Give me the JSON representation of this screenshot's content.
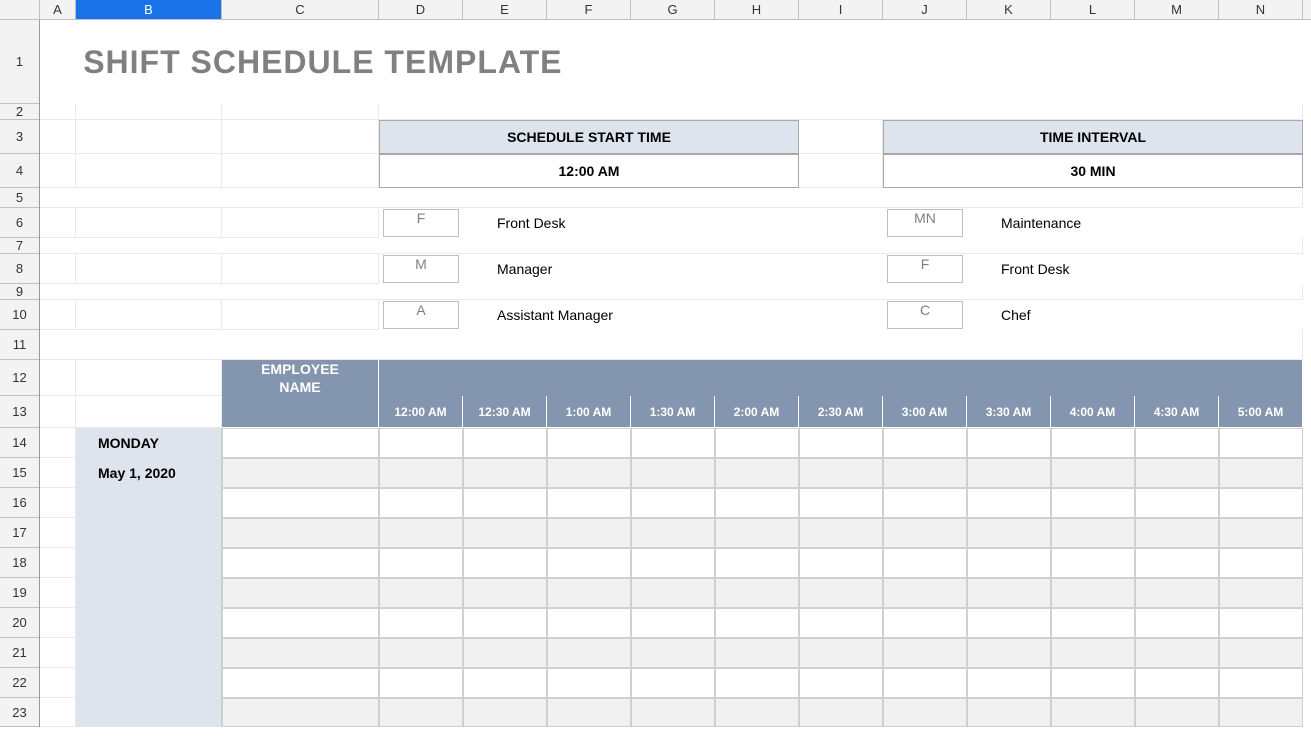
{
  "columns": [
    "A",
    "B",
    "C",
    "D",
    "E",
    "F",
    "G",
    "H",
    "I",
    "J",
    "K",
    "L",
    "M",
    "N"
  ],
  "selected_column": "B",
  "row_numbers": [
    1,
    2,
    3,
    4,
    5,
    6,
    7,
    8,
    9,
    10,
    11,
    12,
    13,
    14,
    15,
    16,
    17,
    18,
    19,
    20,
    21,
    22,
    23
  ],
  "title": "SHIFT SCHEDULE TEMPLATE",
  "schedule_start_time": {
    "label": "SCHEDULE START TIME",
    "value": "12:00 AM"
  },
  "time_interval": {
    "label": "TIME INTERVAL",
    "value": "30 MIN"
  },
  "legend_left": [
    {
      "code": "F",
      "label": "Front Desk"
    },
    {
      "code": "M",
      "label": "Manager"
    },
    {
      "code": "A",
      "label": "Assistant Manager"
    }
  ],
  "legend_right": [
    {
      "code": "MN",
      "label": "Maintenance"
    },
    {
      "code": "F",
      "label": "Front Desk"
    },
    {
      "code": "C",
      "label": "Chef"
    }
  ],
  "employee_name_header": "EMPLOYEE NAME",
  "time_columns": [
    "12:00 AM",
    "12:30 AM",
    "1:00 AM",
    "1:30 AM",
    "2:00 AM",
    "2:30 AM",
    "3:00 AM",
    "3:30 AM",
    "4:00 AM",
    "4:30 AM",
    "5:00 AM"
  ],
  "day": {
    "name": "MONDAY",
    "date": "May 1, 2020"
  }
}
